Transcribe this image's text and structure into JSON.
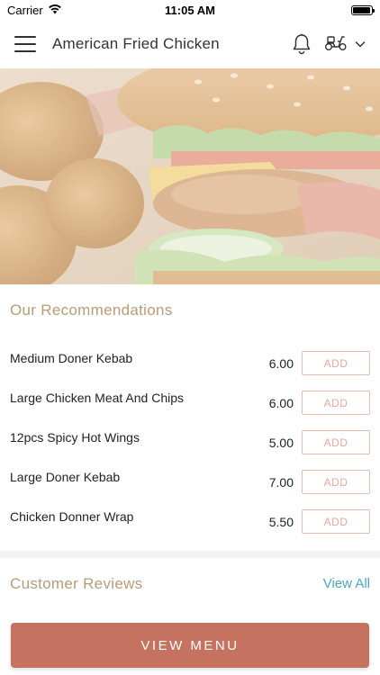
{
  "status_bar": {
    "carrier": "Carrier",
    "time": "11:05 AM",
    "battery_level": 0.95
  },
  "header": {
    "title": "American Fried Chicken",
    "menu_icon": "hamburger-menu-icon",
    "notification_icon": "bell-icon",
    "delivery_icon": "scooter-icon",
    "dropdown_icon": "chevron-down-icon"
  },
  "hero": {
    "image": "burger-and-chicken-nuggets-photo"
  },
  "recommendations": {
    "title": "Our Recommendations",
    "add_label": "ADD",
    "items": [
      {
        "name": "Medium Doner Kebab",
        "price": "6.00"
      },
      {
        "name": "Large Chicken Meat And Chips",
        "price": "6.00"
      },
      {
        "name": "12pcs Spicy Hot Wings",
        "price": "5.00"
      },
      {
        "name": "Large Doner Kebab",
        "price": "7.00"
      },
      {
        "name": "Chicken Donner Wrap",
        "price": "5.50"
      }
    ]
  },
  "reviews": {
    "title": "Customer Reviews",
    "view_all": "View All"
  },
  "footer": {
    "view_menu": "VIEW MENU"
  },
  "colors": {
    "section_title": "#b59c7a",
    "add_border": "#e7b9b2",
    "link": "#4aa7c0",
    "primary_button": "#c57360"
  }
}
